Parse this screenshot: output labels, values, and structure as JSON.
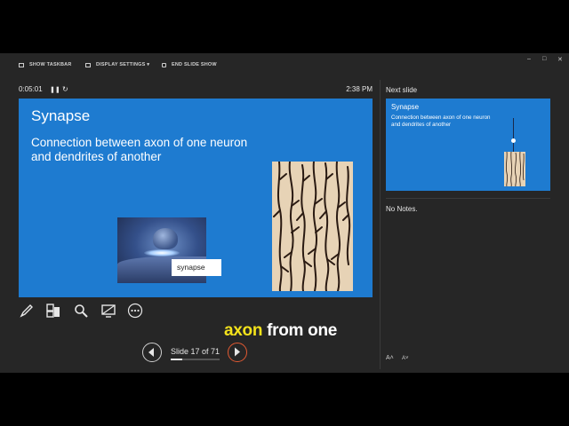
{
  "toolbar": {
    "show_taskbar": "SHOW TASKBAR",
    "display_settings": "DISPLAY SETTINGS ▾",
    "end_slide_show": "END SLIDE SHOW",
    "minimize": "–",
    "restore": "□",
    "close": "✕"
  },
  "timer": {
    "elapsed": "0:05:01",
    "pause_icon": "pause-icon",
    "restart_icon": "restart-icon",
    "clock": "2:38 PM"
  },
  "current_slide": {
    "title": "Synapse",
    "body": "Connection between axon of one neuron and dendrites of another",
    "image_label": "synapse"
  },
  "tools": [
    "pen-icon",
    "slides-grid-icon",
    "zoom-icon",
    "screen-icon",
    "more-icon"
  ],
  "caption": {
    "highlight": "axon",
    "rest": " from one"
  },
  "navigation": {
    "prev_icon": "previous-icon",
    "next_icon": "next-icon",
    "counter": "Slide 17 of 71",
    "current": 17,
    "total": 71
  },
  "next_slide": {
    "label": "Next slide",
    "title": "Synapse",
    "body": "Connection between axon of one neuron and dendrites of another"
  },
  "notes": {
    "text": "No Notes."
  },
  "font_controls": {
    "increase": "A˄",
    "decrease": "A˅"
  },
  "colors": {
    "slide_bg": "#1e7bd0",
    "panel_bg": "#262626",
    "caption_highlight": "#f3e21b",
    "next_button": "#e25a32"
  }
}
